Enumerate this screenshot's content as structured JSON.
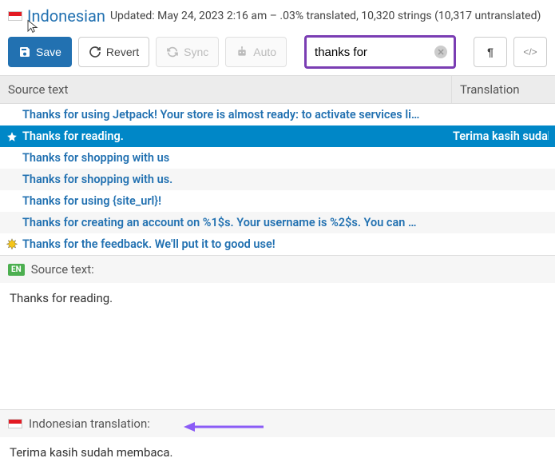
{
  "header": {
    "language": "Indonesian",
    "meta": "Updated: May 24, 2023 2:16 am – .03% translated, 10,320 strings (10,317 untranslated)"
  },
  "toolbar": {
    "save_label": "Save",
    "revert_label": "Revert",
    "sync_label": "Sync",
    "auto_label": "Auto",
    "search_value": "thanks for",
    "pilcrow": "¶",
    "code": "</>"
  },
  "columns": {
    "source": "Source text",
    "translation": "Translation"
  },
  "rows": [
    {
      "text": "Thanks for using Jetpack! Your store is almost ready: to activate services li…",
      "icon": null,
      "selected": false,
      "alt": false,
      "trans": ""
    },
    {
      "text": "Thanks for reading.",
      "icon": "star",
      "selected": true,
      "alt": false,
      "trans": "Terima kasih sudah m"
    },
    {
      "text": "Thanks for shopping with us",
      "icon": null,
      "selected": false,
      "alt": false,
      "trans": ""
    },
    {
      "text": "Thanks for shopping with us.",
      "icon": null,
      "selected": false,
      "alt": true,
      "trans": ""
    },
    {
      "text": "Thanks for using {site_url}!",
      "icon": null,
      "selected": false,
      "alt": false,
      "trans": ""
    },
    {
      "text": "Thanks for creating an account on %1$s. Your username is %2$s. You can …",
      "icon": null,
      "selected": false,
      "alt": true,
      "trans": ""
    },
    {
      "text": "Thanks for the feedback. We'll put it to good use!",
      "icon": "spark",
      "selected": false,
      "alt": false,
      "trans": ""
    }
  ],
  "source_panel": {
    "label": "Source text:",
    "body": "Thanks for reading."
  },
  "translation_panel": {
    "label": "Indonesian translation:",
    "body": "Terima kasih sudah membaca."
  }
}
